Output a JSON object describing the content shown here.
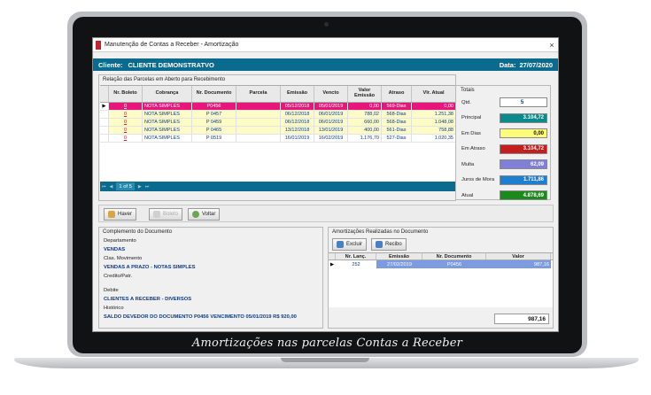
{
  "window": {
    "title": "Manutenção de Contas a Receber - Amortização",
    "close": "×"
  },
  "client": {
    "label": "Cliente:",
    "name": "CLIENTE DEMONSTRATVO",
    "date_label": "Data:",
    "date": "27/07/2020"
  },
  "parcelas": {
    "title": "Relação das Parcelas em Aberto para Recebimento",
    "columns": [
      "Nr. Boleto",
      "Cobrança",
      "Nr. Documento",
      "Parcela",
      "Emissão",
      "Vencto",
      "Valor Emissão",
      "Atraso",
      "Vlr. Atual"
    ],
    "rows": [
      {
        "ind": "▶",
        "boleto": "0",
        "cobranca": "NOTA SIMPLES",
        "documento": "P0456",
        "parcela": "",
        "emissao": "05/12/2018",
        "vencto": "05/01/2019",
        "valor": "0,00",
        "atraso": "569-Dias",
        "atual": "0,00"
      },
      {
        "ind": "",
        "boleto": "0",
        "cobranca": "NOTA SIMPLES",
        "documento": "P 0457",
        "parcela": "",
        "emissao": "06/12/2018",
        "vencto": "06/01/2019",
        "valor": "788,02",
        "atraso": "568-Dias",
        "atual": "1.251,38"
      },
      {
        "ind": "",
        "boleto": "0",
        "cobranca": "NOTA SIMPLES",
        "documento": "P 0459",
        "parcela": "",
        "emissao": "06/12/2018",
        "vencto": "06/01/2019",
        "valor": "660,00",
        "atraso": "568-Dias",
        "atual": "1.048,08"
      },
      {
        "ind": "",
        "boleto": "0",
        "cobranca": "NOTA SIMPLES",
        "documento": "P 0465",
        "parcela": "",
        "emissao": "13/12/2018",
        "vencto": "13/01/2019",
        "valor": "400,00",
        "atraso": "561-Dias",
        "atual": "758,88"
      },
      {
        "ind": "",
        "boleto": "0",
        "cobranca": "NOTA SIMPLES",
        "documento": "P 0519",
        "parcela": "",
        "emissao": "16/01/2019",
        "vencto": "16/02/2019",
        "valor": "1.176,70",
        "atraso": "527-Dias",
        "atual": "1.020,35"
      }
    ],
    "page_info": "1 of 5"
  },
  "totais": {
    "title": "Totais",
    "items": [
      {
        "label": "Qtd.",
        "value": "5",
        "bg": "#ffffff",
        "fg": "#0a3a8a"
      },
      {
        "label": "Principal",
        "value": "3.104,72",
        "bg": "#0a8a8a",
        "fg": "#ffffff"
      },
      {
        "label": "Em Dias",
        "value": "0,00",
        "bg": "#fdfc7a",
        "fg": "#111111"
      },
      {
        "label": "Em Atraso",
        "value": "3.104,72",
        "bg": "#c41f1f",
        "fg": "#ffffff"
      },
      {
        "label": "Multa",
        "value": "62,09",
        "bg": "#8080d8",
        "fg": "#ffffff"
      },
      {
        "label": "Juros de Mora",
        "value": "1.711,86",
        "bg": "#1e7fd0",
        "fg": "#ffffff"
      },
      {
        "label": "Atual",
        "value": "4.878,69",
        "bg": "#1a8a1a",
        "fg": "#ffffff"
      }
    ]
  },
  "buttons": {
    "haver": "Haver",
    "boleto": "Boleto",
    "voltar": "Voltar"
  },
  "complemento": {
    "title": "Complemento do Documento",
    "departamento_label": "Departamento",
    "departamento": "VENDAS",
    "clas_label": "Clas. Movimento",
    "clas": "VENDAS A PRAZO - NOTAS SIMPLES",
    "credito_label": "Credito/Patr.",
    "debite_label": "Debite",
    "debite": "CLIENTES A RECEBER - DIVERSOS",
    "historico_label": "Histórico",
    "historico": "SALDO DEVEDOR DO DOCUMENTO P0456 VENCIMENTO 05/01/2019 R$ 920,00"
  },
  "amortizacoes": {
    "title": "Amortizações Realizadas no Documento",
    "excluir": "Excluir",
    "recibo": "Recibo",
    "columns": [
      "Nr. Lanç.",
      "Emissão",
      "Nr. Documento",
      "Valor"
    ],
    "row": {
      "ind": "▶",
      "lanc": "252",
      "emissao": "27/02/2019",
      "documento": "P0456",
      "valor": "987,16"
    },
    "total": "987,16"
  },
  "caption": "Amortizações nas parcelas Contas a Receber"
}
